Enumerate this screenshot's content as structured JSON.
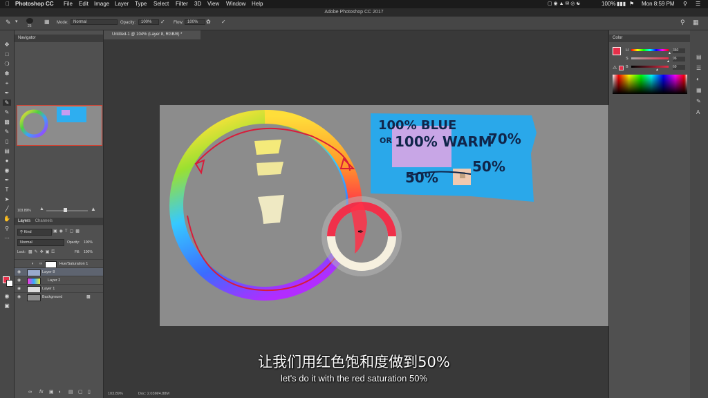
{
  "menubar": {
    "apple_icon": "apple-icon",
    "app_name": "Photoshop CC",
    "items": [
      "File",
      "Edit",
      "Image",
      "Layer",
      "Type",
      "Select",
      "Filter",
      "3D",
      "View",
      "Window",
      "Help"
    ],
    "battery": "100%",
    "clock": "Mon 8:59 PM"
  },
  "titlebar": {
    "title": "Adobe Photoshop CC 2017"
  },
  "options": {
    "brush_size": "25",
    "mode_label": "Mode:",
    "mode_value": "Normal",
    "opacity_label": "Opacity:",
    "opacity_value": "100%",
    "flow_label": "Flow:",
    "flow_value": "100%"
  },
  "navigator": {
    "title": "Navigator",
    "zoom": "103.89%"
  },
  "layers_panel": {
    "tabs": [
      "Layers",
      "Channels"
    ],
    "filter": "Kind",
    "blend_mode": "Normal",
    "opacity_label": "Opacity:",
    "opacity_value": "100%",
    "lock_label": "Lock:",
    "fill_label": "Fill:",
    "fill_value": "100%",
    "layers": [
      {
        "name": "Hue/Saturation 1"
      },
      {
        "name": "Layer 8"
      },
      {
        "name": "Layer 2"
      },
      {
        "name": "Layer 1"
      },
      {
        "name": "Background"
      }
    ],
    "footer_icons": [
      "link-icon",
      "fx-icon",
      "mask-icon",
      "adjustment-icon",
      "folder-icon",
      "new-layer-icon",
      "trash-icon"
    ]
  },
  "document": {
    "tab_title": "Untitled-1 @ 104% (Layer 8, RGB/8) *",
    "status_zoom": "103.89%",
    "status_doc": "Doc: 2.03M/4.88M"
  },
  "canvas_notes": {
    "line1": "100% BLUE",
    "line2a": "OR",
    "line2b": "100% WARM",
    "line2c": "70%",
    "line3a": "50%",
    "line3b": "50%"
  },
  "color_panel": {
    "title": "Color",
    "h_label": "H",
    "h_value": "360",
    "s_label": "S",
    "s_value": "96",
    "b_label": "B",
    "b_value": "69",
    "fg_color": "#e5304a"
  },
  "subtitles": {
    "cn": "让我们用红色饱和度做到50%",
    "en": "let's do it with the red saturation 50%"
  }
}
